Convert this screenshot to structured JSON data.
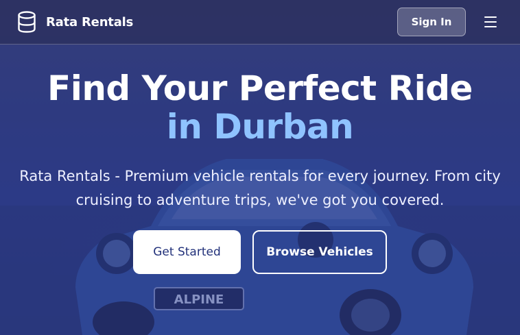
{
  "brand": {
    "name": "Rata Rentals",
    "icon": "database-icon"
  },
  "nav": {
    "signin_label": "Sign In",
    "menu_icon": "hamburger-menu-icon"
  },
  "hero": {
    "title_line1": "Find Your Perfect Ride",
    "title_line2": "in Durban",
    "subtitle": "Rata Rentals - Premium vehicle rentals for every journey. From city cruising to adventure trips, we've got you covered.",
    "plate_text": "ALPINE",
    "primary_cta": "Get Started",
    "secondary_cta": "Browse Vehicles"
  },
  "colors": {
    "accent": "#8fc3ff",
    "overlay": "#2e3c8c",
    "button_text": "#22317a"
  }
}
